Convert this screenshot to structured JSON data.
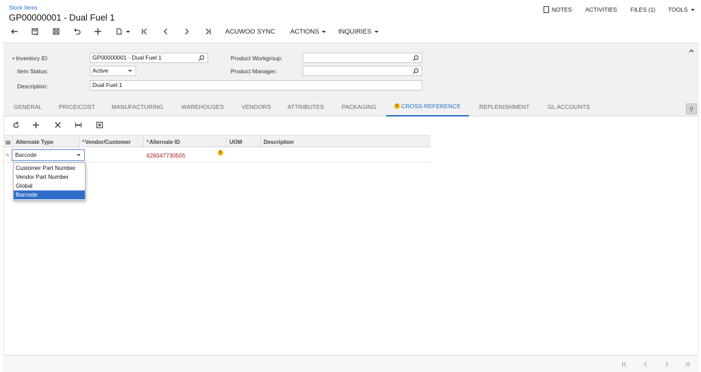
{
  "header": {
    "breadcrumb": "Stock Items",
    "title": "GP00000001 - Dual Fuel 1",
    "links": {
      "notes": "NOTES",
      "activities": "ACTIVITIES",
      "files": "FILES (1)",
      "tools": "TOOLS"
    },
    "toolbar": {
      "acuwoo_sync": "ACUWOO SYNC",
      "actions": "ACTIONS",
      "inquiries": "INQUIRIES"
    }
  },
  "form": {
    "inventory_id_label": "Inventory ID:",
    "inventory_id_value": "GP00000001 - Dual Fuel 1",
    "item_status_label": "Item Status:",
    "item_status_value": "Active",
    "description_label": "Description:",
    "description_value": "Dual Fuel 1",
    "product_workgroup_label": "Product Workgroup:",
    "product_workgroup_value": "",
    "product_manager_label": "Product Manager:",
    "product_manager_value": ""
  },
  "tabs": {
    "general": "GENERAL",
    "price_cost": "PRICE/COST",
    "manufacturing": "MANUFACTURING",
    "warehouses": "WAREHOUSES",
    "vendors": "VENDORS",
    "attributes": "ATTRIBUTES",
    "packaging": "PACKAGING",
    "cross_reference": "CROSS-REFERENCE",
    "replenishment": "REPLENISHMENT",
    "gl_accounts": "GL ACCOUNTS",
    "active": "cross_reference"
  },
  "grid": {
    "columns": {
      "alternate_type": "Alternate Type",
      "vendor_customer": "Vendor/Customer",
      "alternate_id": "Alternate ID",
      "uom": "UOM",
      "description": "Description"
    },
    "row": {
      "alternate_type": "Barcode",
      "vendor_customer": "",
      "alternate_id": "628347730505",
      "uom": "",
      "description": ""
    },
    "dropdown_options": [
      "Customer Part Number",
      "Vendor Part Number",
      "Global",
      "Barcode"
    ],
    "dropdown_selected": "Barcode"
  },
  "colors": {
    "accent": "#1f6ec9",
    "selection": "#2f6fc9",
    "warning": "#f2b300",
    "error_text": "#a22020"
  },
  "icons": [
    "back-icon",
    "save-close-icon",
    "save-icon",
    "undo-icon",
    "add-icon",
    "copy-paste-icon",
    "first-icon",
    "prev-icon",
    "next-icon",
    "last-icon",
    "refresh-icon",
    "delete-icon",
    "fit-columns-icon",
    "export-excel-icon",
    "magnifier-icon",
    "collapse-icon",
    "file-icon"
  ]
}
